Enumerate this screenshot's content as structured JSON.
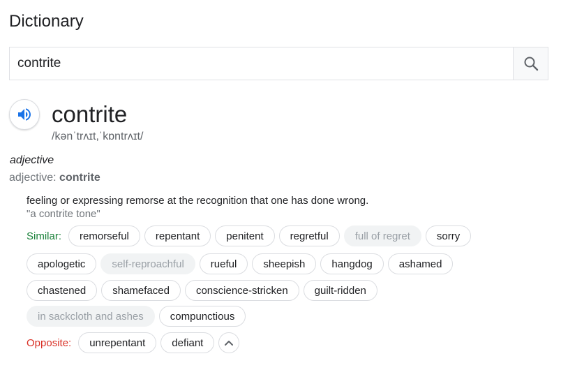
{
  "header": {
    "title": "Dictionary"
  },
  "search": {
    "value": "contrite",
    "icon": "search-icon"
  },
  "entry": {
    "word": "contrite",
    "phonetic": "/kənˈtrʌɪt,ˈkɒntrʌɪt/",
    "pos_italic": "adjective",
    "pos_prefix": "adjective: ",
    "pos_word": "contrite",
    "definition": "feeling or expressing remorse at the recognition that one has done wrong.",
    "example": "\"a contrite tone\""
  },
  "similar": {
    "label": "Similar:",
    "rows": [
      [
        {
          "text": "remorseful",
          "muted": false
        },
        {
          "text": "repentant",
          "muted": false
        },
        {
          "text": "penitent",
          "muted": false
        },
        {
          "text": "regretful",
          "muted": false
        },
        {
          "text": "full of regret",
          "muted": true
        },
        {
          "text": "sorry",
          "muted": false
        }
      ],
      [
        {
          "text": "apologetic",
          "muted": false
        },
        {
          "text": "self-reproachful",
          "muted": true
        },
        {
          "text": "rueful",
          "muted": false
        },
        {
          "text": "sheepish",
          "muted": false
        },
        {
          "text": "hangdog",
          "muted": false
        },
        {
          "text": "ashamed",
          "muted": false
        }
      ],
      [
        {
          "text": "chastened",
          "muted": false
        },
        {
          "text": "shamefaced",
          "muted": false
        },
        {
          "text": "conscience-stricken",
          "muted": false
        },
        {
          "text": "guilt-ridden",
          "muted": false
        }
      ],
      [
        {
          "text": "in sackcloth and ashes",
          "muted": true
        },
        {
          "text": "compunctious",
          "muted": false
        }
      ]
    ]
  },
  "opposite": {
    "label": "Opposite:",
    "items": [
      {
        "text": "unrepentant",
        "muted": false
      },
      {
        "text": "defiant",
        "muted": false
      }
    ]
  },
  "colors": {
    "similar_label": "#188038",
    "opposite_label": "#d93025",
    "speaker_icon": "#1a73e8"
  }
}
